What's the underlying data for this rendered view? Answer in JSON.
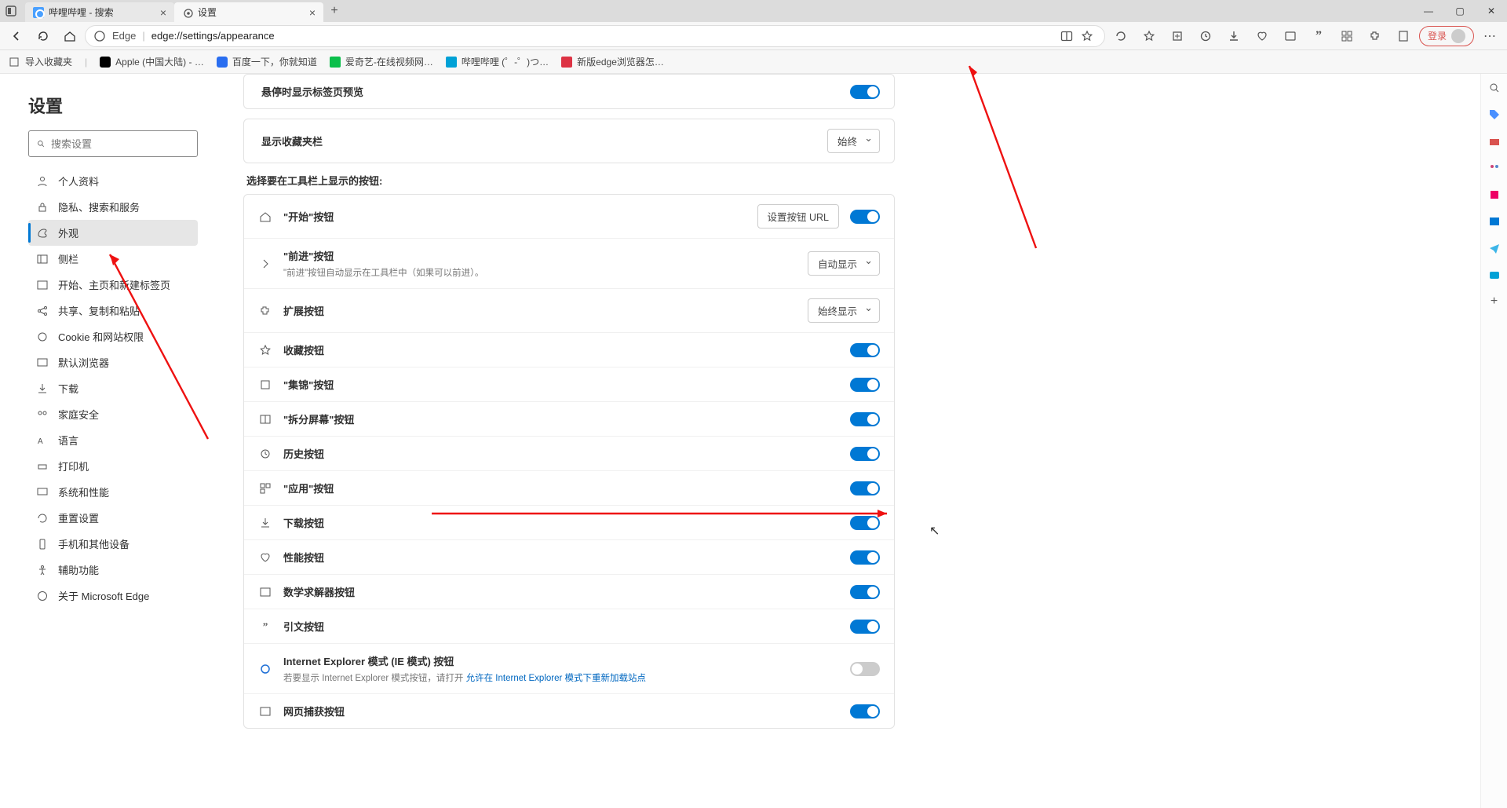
{
  "tabs": [
    {
      "label": "哔哩哔哩 - 搜索"
    },
    {
      "label": "设置"
    }
  ],
  "addr": {
    "prefix": "Edge",
    "url": "edge://settings/appearance"
  },
  "bookmarks": [
    {
      "label": "导入收藏夹"
    },
    {
      "label": "Apple (中国大陆) - …"
    },
    {
      "label": "百度一下，你就知道"
    },
    {
      "label": "爱奇艺-在线视频网…"
    },
    {
      "label": "哔哩哔哩 (゜-゜)つ…"
    },
    {
      "label": "新版edge浏览器怎…"
    }
  ],
  "login_label": "登录",
  "settings_title": "设置",
  "search_placeholder": "搜索设置",
  "nav_items": [
    "个人资料",
    "隐私、搜索和服务",
    "外观",
    "侧栏",
    "开始、主页和新建标签页",
    "共享、复制和粘贴",
    "Cookie 和网站权限",
    "默认浏览器",
    "下载",
    "家庭安全",
    "语言",
    "打印机",
    "系统和性能",
    "重置设置",
    "手机和其他设备",
    "辅助功能",
    "关于 Microsoft Edge"
  ],
  "rows": {
    "hover_preview": "悬停时显示标签页预览",
    "favorites_bar": "显示收藏夹栏",
    "favorites_bar_value": "始终",
    "toolbar_section": "选择要在工具栏上显示的按钮:",
    "home_btn": "\"开始\"按钮",
    "home_url_btn": "设置按钮 URL",
    "forward_btn": "\"前进\"按钮",
    "forward_sub": "\"前进\"按钮自动显示在工具栏中（如果可以前进）。",
    "forward_value": "自动显示",
    "extensions_btn": "扩展按钮",
    "extensions_value": "始终显示",
    "favorites_btn": "收藏按钮",
    "collections_btn": "\"集锦\"按钮",
    "split_btn": "\"拆分屏幕\"按钮",
    "history_btn": "历史按钮",
    "apps_btn": "\"应用\"按钮",
    "download_btn": "下载按钮",
    "performance_btn": "性能按钮",
    "math_btn": "数学求解器按钮",
    "citation_btn": "引文按钮",
    "ie_btn": "Internet Explorer 模式 (IE 模式) 按钮",
    "ie_sub_pre": "若要显示 Internet Explorer 模式按钮，请打开 ",
    "ie_sub_link": "允许在 Internet Explorer 模式下重新加载站点",
    "webcapture_btn": "网页捕获按钮"
  }
}
